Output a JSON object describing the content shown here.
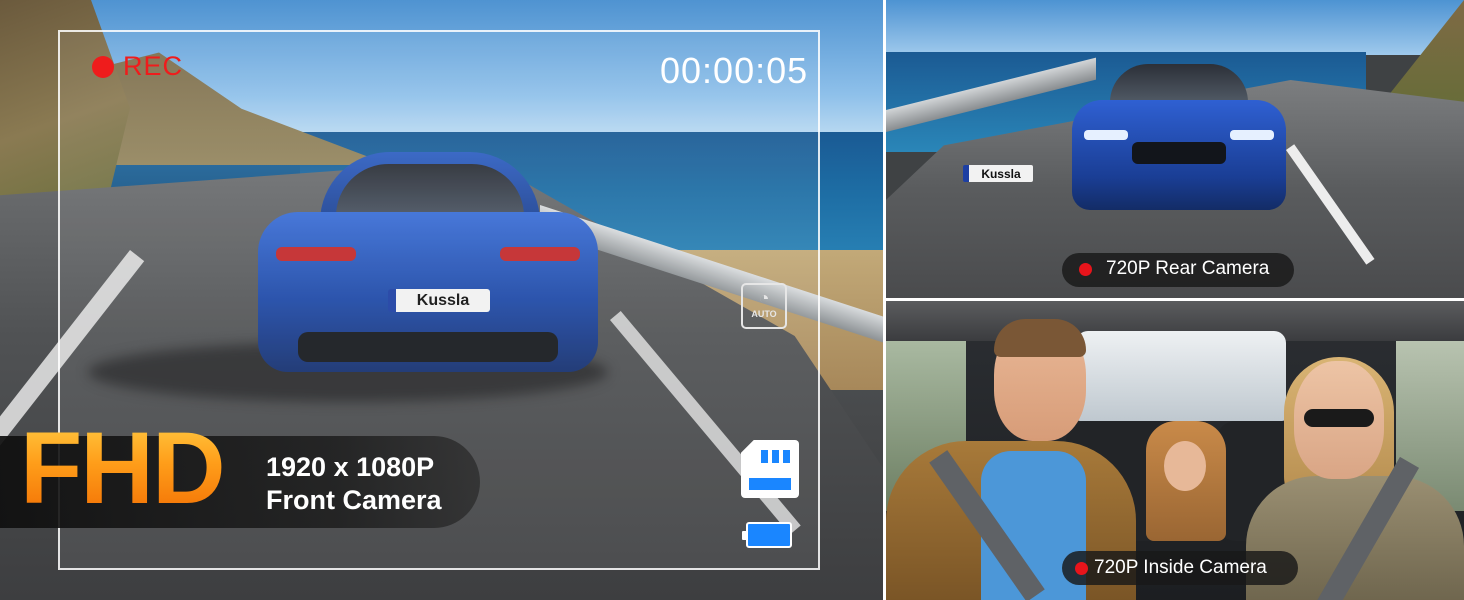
{
  "front_camera": {
    "rec_label": "REC",
    "timer": "00:00:05",
    "fhd_label": "FHD",
    "resolution": "1920 x 1080P",
    "camera_label": "Front Camera",
    "plate_text": "Kussla",
    "auto_icon_text": "AUTO",
    "colors": {
      "rec": "#ef1c1c",
      "fhd_gradient_top": "#ffd24a",
      "fhd_gradient_bottom": "#f06800",
      "status_icons": "#1a86ff"
    },
    "icons": [
      "rec-dot-icon",
      "auto-headlight-icon",
      "sd-card-icon",
      "battery-icon"
    ]
  },
  "rear_camera": {
    "label": "720P Rear Camera",
    "plate_text": "Kussla",
    "dot_color": "#e8141b"
  },
  "inside_camera": {
    "label": "720P Inside Camera",
    "dot_color": "#e8141b"
  }
}
